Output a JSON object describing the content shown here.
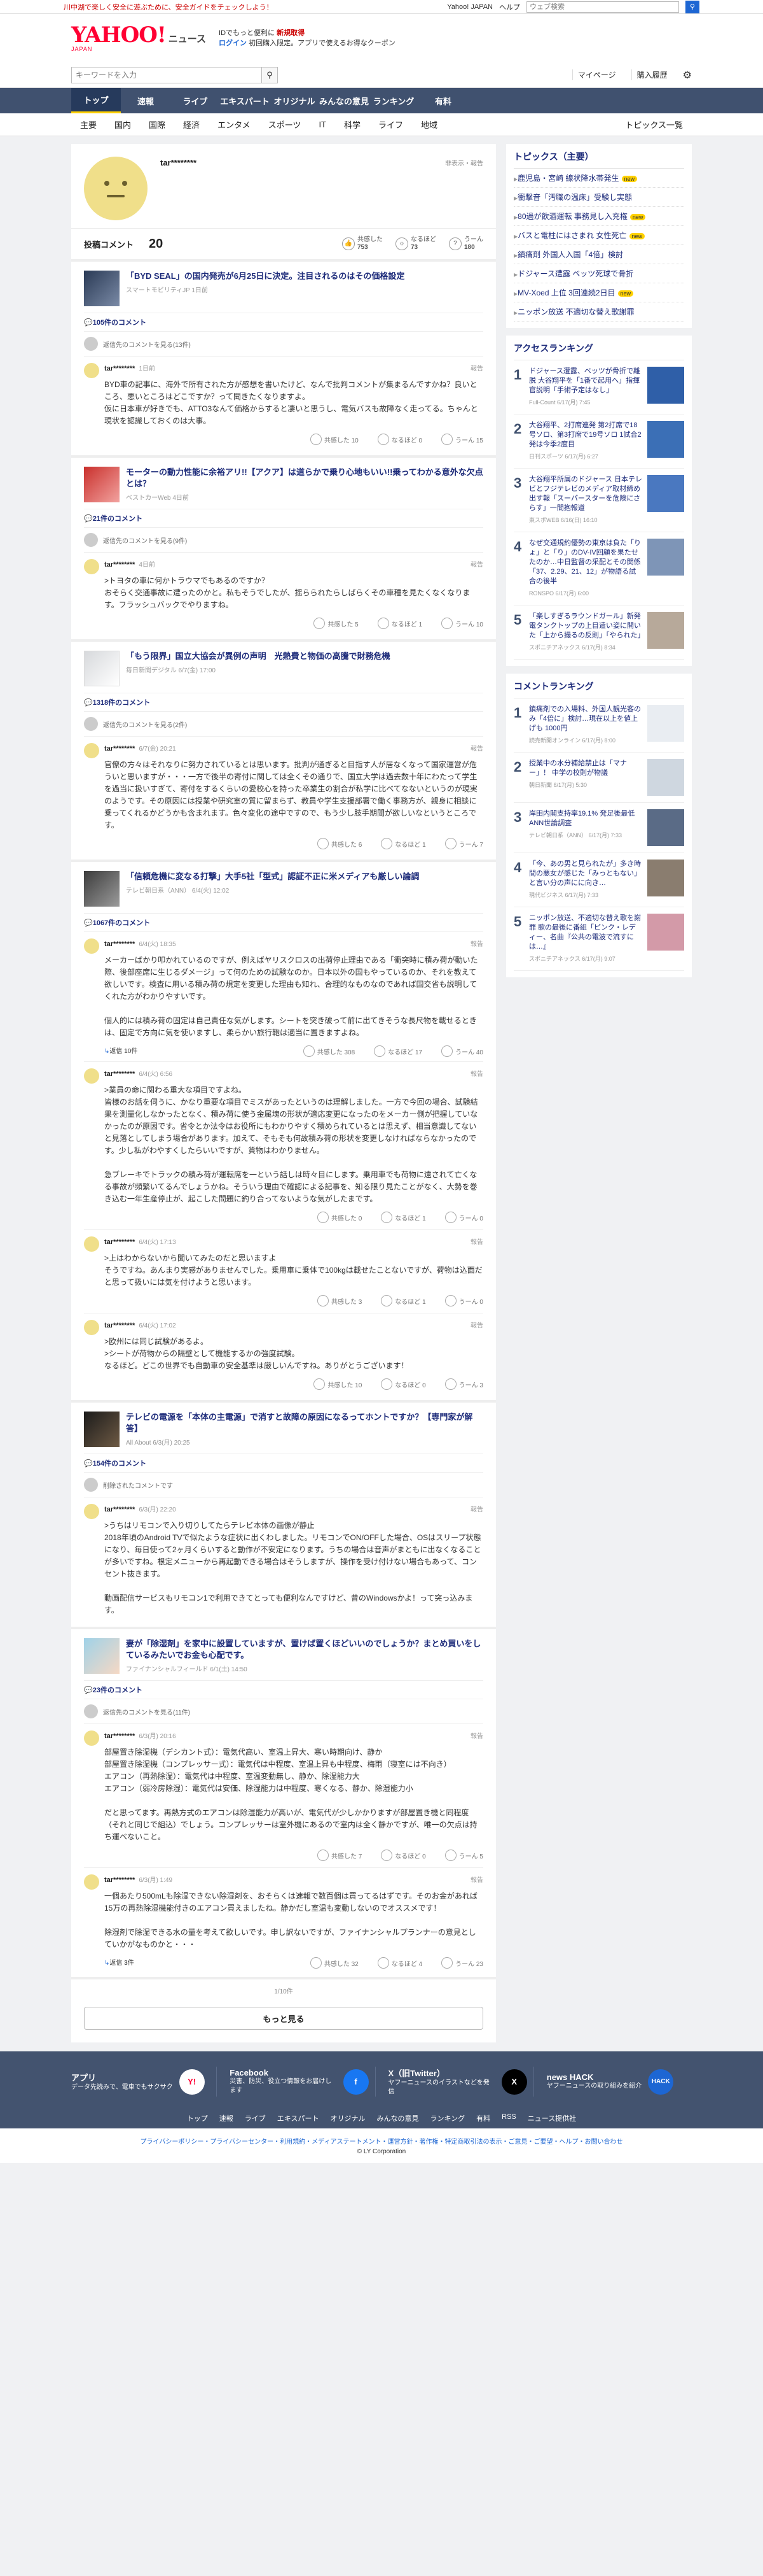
{
  "topline": {
    "promo": "川中湖で楽しく安全に遊ぶために、安全ガイドをチェックしよう！",
    "links": [
      "Yahoo! JAPAN",
      "ヘルプ"
    ],
    "search_placeholder": "ウェブ検索"
  },
  "header": {
    "logo_main": "YAHOO!",
    "logo_sub": "JAPAN",
    "logo_news": "ニュース",
    "promo_line1": "IDでもっと便利に",
    "promo_line1_bold": "新規取得",
    "promo_login": "ログイン",
    "promo_line2": "初回購入限定。アプリで使えるお得なクーポン"
  },
  "searchrow": {
    "placeholder": "キーワードを入力",
    "links": [
      "マイページ",
      "購入履歴"
    ]
  },
  "gnav": [
    "トップ",
    "速報",
    "ライブ",
    "エキスパート",
    "オリジナル",
    "みんなの意見",
    "ランキング",
    "有料"
  ],
  "snav": [
    "主要",
    "国内",
    "国際",
    "経済",
    "エンタメ",
    "スポーツ",
    "IT",
    "科学",
    "ライフ",
    "地域"
  ],
  "snav_right": "トピックス一覧",
  "profile": {
    "name": "tar********",
    "block": "非表示・報告",
    "comments_label": "投稿コメント",
    "comments_count": "20",
    "stats": [
      {
        "label": "共感した",
        "value": "753"
      },
      {
        "label": "なるほど",
        "value": "73"
      },
      {
        "label": "うーん",
        "value": "180"
      }
    ]
  },
  "articles": [
    {
      "title": "「BYD SEAL」の国内発売が6月25日に決定。注目されるのはその価格設定",
      "source": "スマートモビリティJP 1日前",
      "count": "105件のコメント",
      "reply_text": "返信先のコメントを見る(13件)",
      "comments": [
        {
          "user": "tar********",
          "time": "1日前",
          "report": "報告",
          "text": "BYD車の記事に、海外で所有された方が感想を書いたけど、なんで批判コメントが集まるんですかね？良いところ、悪いところはどこですか？って聞きたくなりますよ。\n仮に日本車が好きでも、ATTO3なんて価格からすると凄いと思うし、電気バスも故障なく走ってる。ちゃんと現状を認識しておくのは大事。",
          "reactions": [
            "共感した 10",
            "なるほど 0",
            "うーん 15"
          ]
        }
      ]
    },
    {
      "title": "モーターの動力性能に余裕アリ!!【アクア】は道らかで乗り心地もいい!!乗ってわかる意外な欠点とは？",
      "source": "ベストカーWeb 4日前",
      "count": "21件のコメント",
      "reply_text": "返信先のコメントを見る(9件)",
      "comments": [
        {
          "user": "tar********",
          "time": "4日前",
          "report": "報告",
          "text": ">トヨタの車に何かトラウマでもあるのですか？\nおそらく交通事故に遭ったのかと。私もそうでしたが、揺らられたらしばらくその車種を見たくなくなります。フラッシュバックでやりますね。",
          "reactions": [
            "共感した 5",
            "なるほど 1",
            "うーん 10"
          ]
        }
      ]
    },
    {
      "title": "「もう限界」国立大協会が異例の声明　光熱費と物価の高騰で財務危機",
      "source": "毎日新聞デジタル 6/7(金) 17:00",
      "count": "1318件のコメント",
      "reply_text": "返信先のコメントを見る(2件)",
      "comments": [
        {
          "user": "tar********",
          "time": "6/7(金) 20:21",
          "report": "報告",
          "text": "官僚の方々はそれなりに努力されているとは思います。批判が通ぎると目指す人が居なくなって国家運営が危ういと思いますが・・・一方で後半の寄付に関しては全くその通りで、国立大学は過去数十年にわたって学生を過当に扱いすぎて、寄付をするくらいの愛校心を持った卒業生の割合が私学に比べてなないというのが現実のようです。その原因には授業や研究室の質に留まらず、教員や学生支援部署で働く事務方が、親身に相談に乗ってくれるかどうかも含まれます。色々変化の途中ですので、もう少し肢手期間が欲しいなというところです。",
          "reactions": [
            "共感した 6",
            "なるほど 1",
            "うーん 7"
          ]
        }
      ]
    },
    {
      "title": "「信頼危機に変なる打撃」大手5社「型式」認証不正に米メディアも厳しい論調",
      "source": "テレビ朝日系（ANN） 6/4(火) 12:02",
      "count": "1067件のコメント",
      "reply_text": "",
      "comments": [
        {
          "user": "tar********",
          "time": "6/4(火) 18:35",
          "report": "報告",
          "text": "メーカーばかり叩かれているのですが、例えばヤリスクロスの出荷停止理由である「衝突時に積み荷が動いた際、後部座席に生じるダメージ」って何のための試験なのか。日本以外の国もやっているのか、それを教えて欲しいです。検査に用いる積み荷の規定を変更した理由も知れ、合理的なものなのであれば国交省も説明してくれた方がわかりやすいです。\n\n個人的には積み荷の固定は自己責任な気がします。シートを突き破って前に出てきそうな長尺物を載せるときは、固定で方向に気を使いますし、柔らかい旅行鞄は適当に置きますよね。",
          "reactions": [
            "共感した 308",
            "なるほど 17",
            "うーん 40"
          ],
          "replies": "返信 10件"
        },
        {
          "user": "tar********",
          "time": "6/4(火) 6:56",
          "report": "報告",
          "text": ">業員の命に関わる重大な項目ですよね。\n皆様のお話を伺うに、かなり重要な項目でミスがあったというのは理解しました。一方で今回の場合、試験結果を測量化しなかったとなく、積み荷に使う金属塊の形状が適応変更になったのをメーカー側が把握していなかったのが原因です。省令とか法令はお役所にもわかりやすく積められているとは思えず、相当意識してないと見落としてしまう場合があります。加えて、そもそも何故積み荷の形状を変更しなければならなかったのです。少し私がわやすくしたらいいですが、貨物はわかりません。\n\n急ブレーキでトラックの積み荷が運転席を一という話しは時々目にします。乗用車でも荷物に遠されて亡くなる事故が頻繁いてるんでしょうかね。そういう理由で確認による記事を、知る限り見たことがなく、大勢を巻き込む一年生産停止が、起こした問題に釣り合ってないような気がしたまです。",
          "reactions": [
            "共感した 0",
            "なるほど 1",
            "うーん 0"
          ]
        },
        {
          "user": "tar********",
          "time": "6/4(火) 17:13",
          "report": "報告",
          "text": ">上はわからないから聞いてみたのだと思いますよ\nそうですね。あんまり実感がありませんでした。乗用車に乗体で100kgは載せたことないですが、荷物は込面だと思って扱いには気を付けようと思います。",
          "reactions": [
            "共感した 3",
            "なるほど 1",
            "うーん 0"
          ]
        },
        {
          "user": "tar********",
          "time": "6/4(火) 17:02",
          "report": "報告",
          "text": ">欧州には同じ試験があるよ。\n>シートが荷物からの隔壁として機能するかの強度試験。\nなるほど。どこの世界でも自動車の安全基準は厳しいんですね。ありがとうございます！",
          "reactions": [
            "共感した 10",
            "なるほど 0",
            "うーん 3"
          ]
        }
      ]
    },
    {
      "title": "テレビの電源を「本体の主電源」で消すと故障の原因になるってホントですか？【専門家が解答】",
      "source": "All About 6/3(月) 20:25",
      "count": "154件のコメント",
      "reply_text": "削除されたコメントです",
      "comments": [
        {
          "user": "tar********",
          "time": "6/3(月) 22:20",
          "report": "報告",
          "text": ">うちはリモコンで入り切りしてたらテレビ本体の画像が静止\n2018年頃のAndroid TVで似たような症状に出くわしました。リモコンでON/OFFした場合、OSはスリープ状態になり、毎日使って2ヶ月くらいすると動作が不安定になります。うちの場合は音声がまともに出なくなることが多いですね。根定メニューから再起動できる場合はそうしますが、操作を受け付けない場合もあって、コンセント抜きます。\n\n動画配信サービスもリモコン1で利用できてとっても便利なんですけど、昔のWindowsかよ！って突っ込みます。",
          "reactions": []
        }
      ]
    },
    {
      "title": "妻が「除湿剤」を家中に設置していますが、置けば置くほどいいのでしょうか？まとめ買いをしているみたいでお金も心配です。",
      "source": "ファイナンシャルフィールド 6/1(土) 14:50",
      "count": "23件のコメント",
      "reply_text": "返信先のコメントを見る(11件)",
      "comments": [
        {
          "user": "tar********",
          "time": "6/3(月) 20:16",
          "report": "報告",
          "text": "部屋置き除湿機（デシカント式）：電気代高い、室温上昇大、寒い時期向け、静か\n部屋置き除湿機（コンプレッサー式）：電気代は中程度、室温上昇も中程度、梅雨（寝室には不向き）\nエアコン（再熱除湿）：電気代は中程度、室温変動無し、静か、除湿能力大\nエアコン（弱冷房除湿）：電気代は安価、除湿能力は中程度、寒くなる、静か、除湿能力小\n\nだと思ってます。再熱方式のエアコンは除湿能力が高いが、電気代が少しかかりますが部屋置き機と同程度（それと同じで組込）でしょう。コンプレッサーは室外機にあるので室内は全く静かですが、唯一の欠点は持ち運べないこと。",
          "reactions": [
            "共感した 7",
            "なるほど 0",
            "うーん 5"
          ]
        },
        {
          "user": "tar********",
          "time": "6/3(月) 1:49",
          "report": "報告",
          "text": "一個あたり500mLも除湿できない除湿剤を、おそらくは速報で数百個は買ってるはずです。そのお金があれば15万の再熱除湿機能付きのエアコン買えましたね。静かだし室温も変動しないのでオススメです！\n\n除湿剤で除湿できる水の量を考えて欲しいです。申し訳ないですが、ファイナンシャルプランナーの意見としていかがなものかと・・・",
          "reactions": [
            "共感した 32",
            "なるほど 4",
            "うーん 23"
          ],
          "replies": "返信 3件"
        }
      ]
    }
  ],
  "more": {
    "page": "1/10件",
    "button": "もっと見る"
  },
  "topics": {
    "title": "トピックス（主要）",
    "items": [
      {
        "text": "鹿児島・宮崎 線状降水帯発生",
        "badge": "new"
      },
      {
        "text": "衝撃音「汚職の温床」受験し実態",
        "badge": ""
      },
      {
        "text": "80過が飲酒運転 事務見し入充権",
        "badge": "new"
      },
      {
        "text": "バスと電柱にはさまれ 女性死亡",
        "badge": "new"
      },
      {
        "text": "鎮痛剤 外国人入国「4倍」検討",
        "badge": ""
      },
      {
        "text": "ドジャース遭露 ベッツ死球で骨折",
        "badge": ""
      },
      {
        "text": "MV-Xoed 上位 3回連続2日目",
        "badge": "new"
      },
      {
        "text": "ニッポン放送 不適切な替え歌謝罪",
        "badge": ""
      }
    ]
  },
  "access_ranking": {
    "title": "アクセスランキング",
    "items": [
      {
        "no": "1",
        "text": "ドジャース遭露、ベッツが骨折で離脱 大谷翔平を「1番で起用へ」指揮官説明「手術予定はなし」",
        "src": "Full-Count 6/17(月) 7:45"
      },
      {
        "no": "2",
        "text": "大谷翔平、2打席連発 第2打席で18号ソロ、第3打席で19号ソロ 1試合2発は今季2度目",
        "src": "日刊スポーツ 6/17(月) 6:27"
      },
      {
        "no": "3",
        "text": "大谷翔平所属のドジャース 日本テレビとフジテレビのメディア取材締め出す報「スーパースターを危険にさらす」一間抱報道",
        "src": "東スポWEB 6/16(日) 16:10"
      },
      {
        "no": "4",
        "text": "なぜ交通規約優勢の東京は負た「りょ」と「り」のDV-IV回顧を果たせたのか…中日監督の采配とその関係「37、2.29、21、12」が物語る試合の後半",
        "src": "RONSPO 6/17(月) 6:00"
      },
      {
        "no": "5",
        "text": "「楽しすぎるラウンドガール」新発電タンクトップの上目遣い姿に開いた「上から撮るの反則」「やられた」",
        "src": "スポニチアネックス 6/17(月) 8:34"
      }
    ]
  },
  "comment_ranking": {
    "title": "コメントランキング",
    "items": [
      {
        "no": "1",
        "text": "鎮痛剤での入場料、外国人観光客のみ「4倍に」検討…現在以上を値上げも 1000円",
        "src": "読売新聞オンライン 6/17(月) 8:00"
      },
      {
        "no": "2",
        "text": "授業中の水分補給禁止は「マナー」！ 中学の校則が物議",
        "src": "朝日新聞 6/17(月) 5:30"
      },
      {
        "no": "3",
        "text": "岸田内閣支持率19.1% 発足後最低 ANN世論調査",
        "src": "テレビ朝日系（ANN） 6/17(月) 7:33"
      },
      {
        "no": "4",
        "text": "「今、あの男と見られたが」多き時間の悪女が感じた「みっともない」と言い分の声にに向き…",
        "src": "現代ビジネス 6/17(月) 7:33"
      },
      {
        "no": "5",
        "text": "ニッポン放送、不適切な替え歌を謝罪 歌の最後に番組「ピンク・レディー、名曲『公共の電波で流すには…』",
        "src": "スポニチアネックス 6/17(月) 9:07"
      }
    ]
  },
  "footer": {
    "apps": [
      {
        "name": "アプリ",
        "desc": "データ先読みで、電車でもサクサク",
        "icon": "Y!"
      },
      {
        "name": "Facebook",
        "desc": "災害、防災、役立つ情報をお届けします",
        "icon": "f"
      },
      {
        "name": "X（旧Twitter）",
        "desc": "ヤフーニュースのイラストなどを発信",
        "icon": "X"
      },
      {
        "name": "news HACK",
        "desc": "ヤフーニュースの取り組みを紹介",
        "icon": "HACK"
      }
    ],
    "links": [
      "トップ",
      "速報",
      "ライブ",
      "エキスパート",
      "オリジナル",
      "みんなの意見",
      "ランキング",
      "有料",
      "RSS",
      "ニュース提供社"
    ],
    "bottom_links": "プライバシーポリシー・プライバシーセンター・利用規約・メディアステートメント・運営方針・著作権・特定商取引法の表示・ご意見・ご要望・ヘルプ・お問い合わせ",
    "copyright": "© LY Corporation"
  }
}
